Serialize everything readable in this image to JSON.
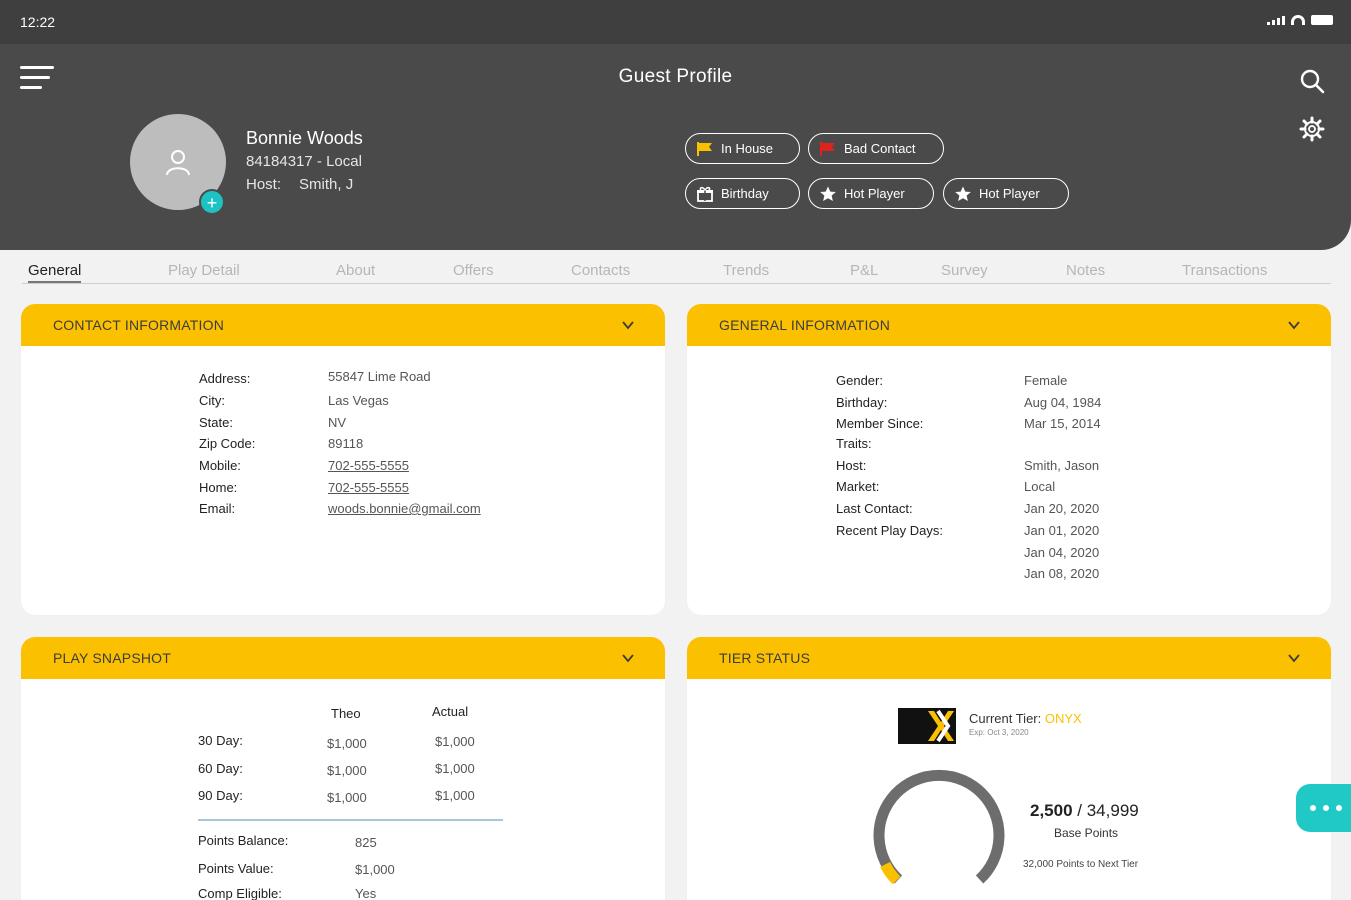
{
  "status_bar": {
    "time": "12:22"
  },
  "header": {
    "title": "Guest Profile"
  },
  "guest": {
    "name": "Bonnie Woods",
    "id_line": "84184317 -  Local",
    "host_label": "Host:",
    "host_value": "Smith, J"
  },
  "chips": [
    {
      "label": "In House",
      "icon": "flag-icon",
      "color": "#fbc100"
    },
    {
      "label": "Bad Contact",
      "icon": "flag-icon",
      "color": "#e0221c"
    },
    {
      "label": "Birthday",
      "icon": "gift-icon",
      "color": "#ffffff"
    },
    {
      "label": "Hot Player",
      "icon": "star-icon",
      "color": "#ffffff"
    },
    {
      "label": "Hot Player",
      "icon": "star-icon",
      "color": "#ffffff"
    }
  ],
  "tabs": [
    "General",
    "Play Detail",
    "About",
    "Offers",
    "Contacts",
    "Trends",
    "P&L",
    "Survey",
    "Notes",
    "Transactions"
  ],
  "contact_info": {
    "title": "CONTACT INFORMATION",
    "rows": [
      {
        "label": "Address:",
        "value": "55847 Lime Road"
      },
      {
        "label": "City:",
        "value": "Las Vegas"
      },
      {
        "label": "State:",
        "value": "NV"
      },
      {
        "label": "Zip Code:",
        "value": "89118"
      },
      {
        "label": "Mobile:",
        "value": "702-555-5555"
      },
      {
        "label": "Home:",
        "value": "702-555-5555"
      },
      {
        "label": "Email:",
        "value": "woods.bonnie@gmail.com"
      }
    ]
  },
  "general_info": {
    "title": "GENERAL INFORMATION",
    "rows": [
      {
        "label": "Gender:",
        "value": "Female"
      },
      {
        "label": "Birthday:",
        "value": "Aug 04, 1984"
      },
      {
        "label": "Member Since:",
        "value": "Mar 15, 2014"
      },
      {
        "label": "Traits:",
        "value": ""
      },
      {
        "label": "Host:",
        "value": "Smith, Jason"
      },
      {
        "label": "Market:",
        "value": "Local"
      },
      {
        "label": "Last Contact:",
        "value": "Jan 20, 2020"
      },
      {
        "label": "Recent Play Days:",
        "value": "Jan 01, 2020"
      },
      {
        "label": "",
        "value": "Jan 04, 2020"
      },
      {
        "label": "",
        "value": "Jan 08, 2020"
      }
    ]
  },
  "play_snapshot": {
    "title": "PLAY SNAPSHOT",
    "col_theo": "Theo",
    "col_actual": "Actual",
    "rows": [
      {
        "label": "30 Day:",
        "theo": "$1,000",
        "actual": "$1,000"
      },
      {
        "label": "60 Day:",
        "theo": "$1,000",
        "actual": "$1,000"
      },
      {
        "label": "90 Day:",
        "theo": "$1,000",
        "actual": "$1,000"
      }
    ],
    "points_rows": [
      {
        "label": "Points Balance:",
        "value": "825"
      },
      {
        "label": "Points Value:",
        "value": "$1,000"
      },
      {
        "label": "Comp Eligible:",
        "value": "Yes"
      }
    ]
  },
  "tier_status": {
    "title": "TIER STATUS",
    "current_label": "Current Tier:",
    "tier_name": "ONYX",
    "tier_color": "#fbc100",
    "expiry": "Exp: Oct 3, 2020",
    "points": "2,500",
    "points_total": "/ 34,999",
    "points_caption": "Base Points",
    "next_tier": "32,000 Points to Next Tier",
    "progress_fraction": 0.07
  },
  "colors": {
    "accent": "#fbc100",
    "header_bg": "#4a4a4a",
    "fab": "#20c9c6"
  },
  "fab": {
    "icon": "more-icon"
  }
}
